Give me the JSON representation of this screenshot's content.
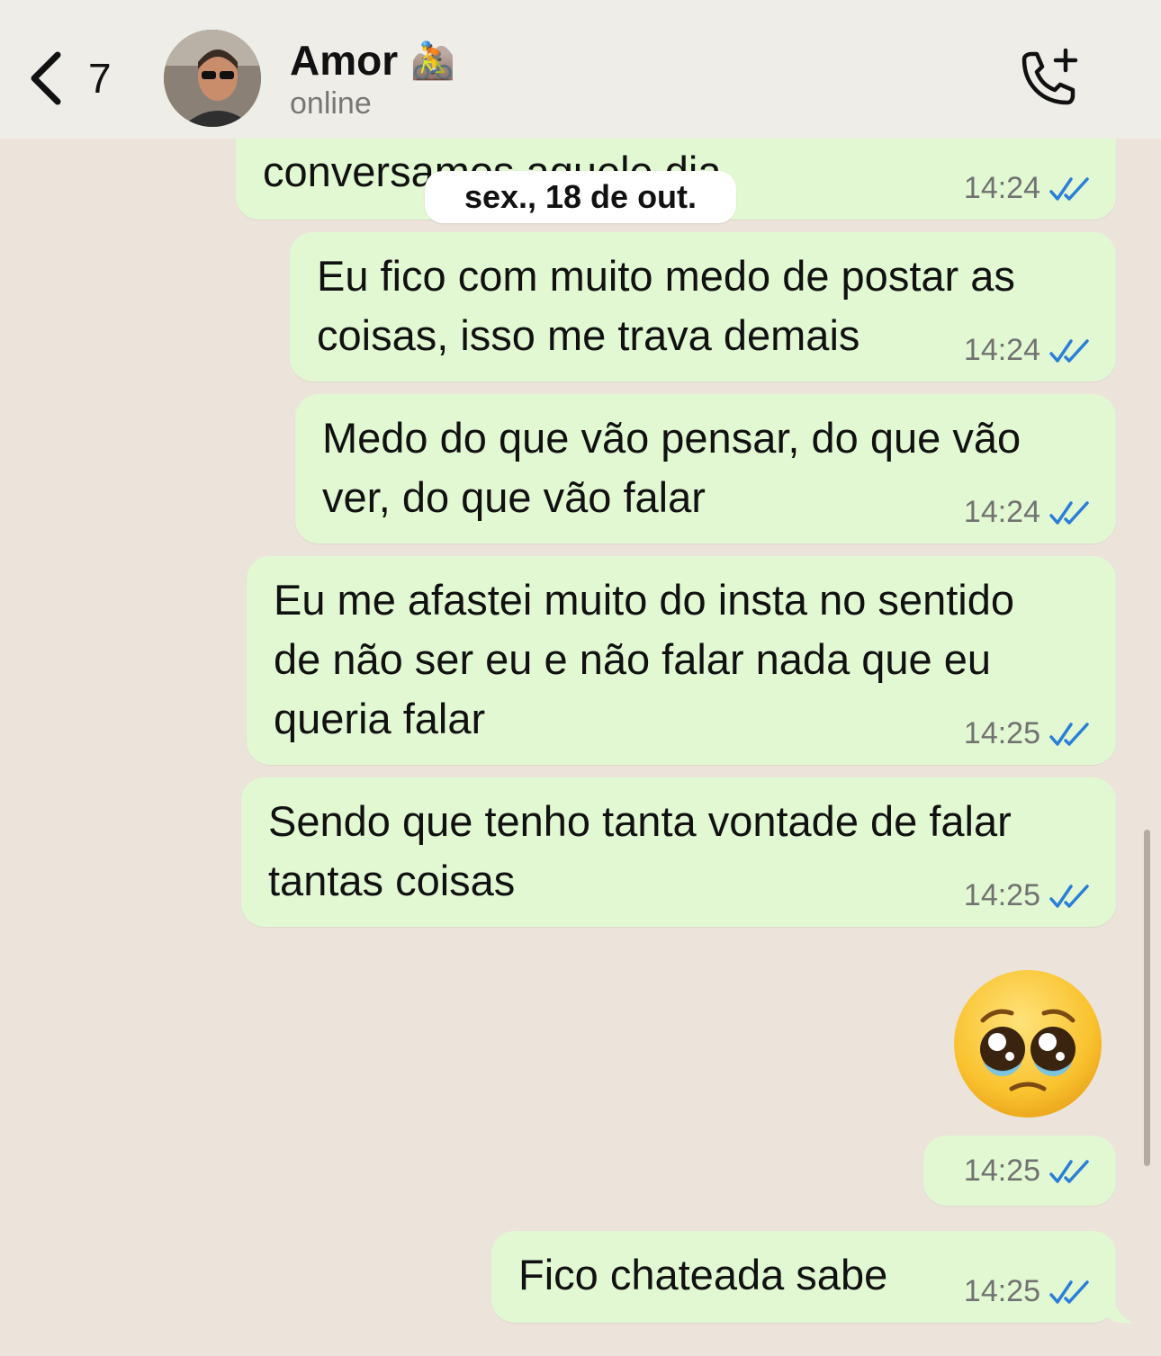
{
  "header": {
    "back_count": "7",
    "contact_name": "Amor",
    "name_emoji": "🚵",
    "status": "online",
    "back_icon": "chevron-left-icon",
    "call_icon": "add-call-icon"
  },
  "date_separator": "sex., 18 de out.",
  "messages": [
    {
      "text": "conversamos aquele dia",
      "time": "14:24",
      "read": true
    },
    {
      "text": "Eu fico com muito medo de postar as\ncoisas, isso me trava demais",
      "time": "14:24",
      "read": true
    },
    {
      "text": "Medo do que vão pensar, do que vão\nver, do que vão falar",
      "time": "14:24",
      "read": true
    },
    {
      "text": "Eu me afastei muito do insta no sentido\nde não ser eu e não falar nada que eu\nqueria falar",
      "time": "14:25",
      "read": true
    },
    {
      "text": "Sendo que tenho tanta vontade de falar\ntantas coisas",
      "time": "14:25",
      "read": true
    },
    {
      "emoji": "pleading-face",
      "time": "14:25",
      "read": true
    },
    {
      "text": "Fico chateada sabe",
      "time": "14:25",
      "read": true
    }
  ],
  "colors": {
    "outgoing_bubble": "#e2f8d3",
    "chat_background": "#ece4da",
    "header_background": "#eeede8",
    "read_ticks": "#2b7ed8"
  }
}
